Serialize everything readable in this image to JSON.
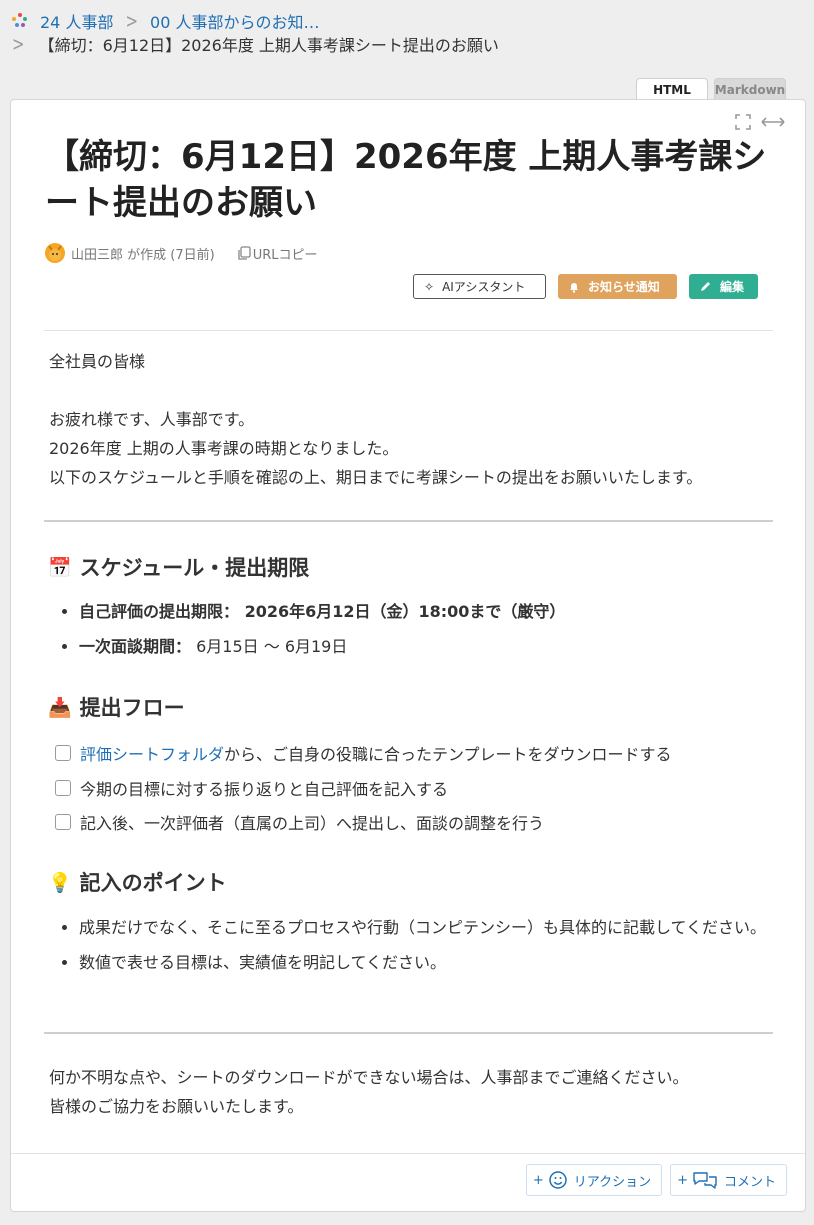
{
  "breadcrumb": {
    "parent": "24 人事部",
    "child": "00 人事部からのお知…",
    "current": "【締切：6月12日】2026年度 上期人事考課シート提出のお願い"
  },
  "tabs": {
    "html": "HTML",
    "markdown": "Markdown"
  },
  "page": {
    "title": "【締切：6月12日】2026年度 上期人事考課シート提出のお願い",
    "author_line": "山田三郎 が作成 (7日前)",
    "copy_url": "URLコピー"
  },
  "actions": {
    "ai": "AIアシスタント",
    "notify": "お知らせ通知",
    "edit": "編集"
  },
  "content": {
    "greeting": "全社員の皆様",
    "intro1": "お疲れ様です、人事部です。",
    "intro2": "2026年度 上期の人事考課の時期となりました。",
    "intro3": "以下のスケジュールと手順を確認の上、期日までに考課シートの提出をお願いいたします。",
    "schedule": {
      "emoji": "📅",
      "heading": "スケジュール・提出期限",
      "item1": "自己評価の提出期限： 2026年6月12日（金）18:00まで（厳守）",
      "item2_label": "一次面談期間：",
      "item2_value": " 6月15日 〜 6月19日"
    },
    "flow": {
      "emoji": "📥",
      "heading": "提出フロー",
      "step1_link": "評価シートフォルダ",
      "step1_rest": "から、ご自身の役職に合ったテンプレートをダウンロードする",
      "step2": "今期の目標に対する振り返りと自己評価を記入する",
      "step3": "記入後、一次評価者（直属の上司）へ提出し、面談の調整を行う"
    },
    "points": {
      "emoji": "💡",
      "heading": "記入のポイント",
      "item1": "成果だけでなく、そこに至るプロセスや行動（コンピテンシー）も具体的に記載してください。",
      "item2": "数値で表せる目標は、実績値を明記してください。"
    },
    "closing1": "何か不明な点や、シートのダウンロードができない場合は、人事部までご連絡ください。",
    "closing2": "皆様のご協力をお願いいたします。"
  },
  "footer": {
    "reaction": "リアクション",
    "comment": "コメント"
  }
}
